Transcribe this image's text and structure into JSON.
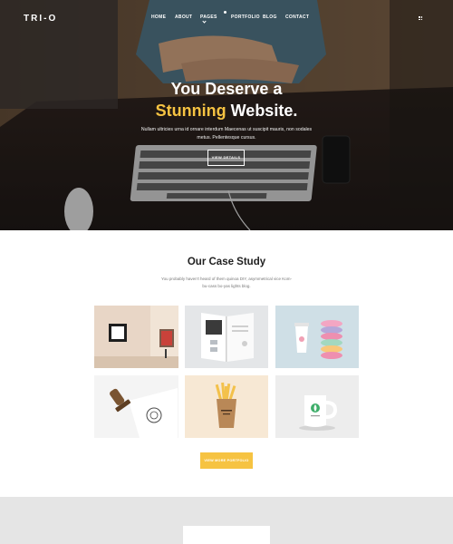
{
  "brand": {
    "logo_text": "TRI-O",
    "accent_color": "#f6c342"
  },
  "nav": {
    "items": [
      {
        "label": "HOME"
      },
      {
        "label": "ABOUT"
      },
      {
        "label": "PAGES"
      },
      {
        "label": "PORTFOLIO"
      },
      {
        "label": "BLOG"
      },
      {
        "label": "CONTACT"
      }
    ],
    "menu_icon": "grid-menu-icon"
  },
  "hero": {
    "title_line1": "You Deserve a",
    "title_accent": "Stunning",
    "title_rest": " Website.",
    "subtitle": "Nullam ultricies urna id ornare interdum Maecenas ut suscipit mauris, non sodales metus. Pellentesque cursus.",
    "button_label": "VIEW DETAILS"
  },
  "case_study": {
    "title": "Our Case Study",
    "subtitle": "You probably haven't heard of them quinoa DIY, asymmetrical vice Kom-bu-cass bo-yas lights blog.",
    "tiles": [
      {
        "name": "gallery-frame"
      },
      {
        "name": "open-book"
      },
      {
        "name": "coffee-cup-macarons"
      },
      {
        "name": "stamp-seal"
      },
      {
        "name": "fries-packaging"
      },
      {
        "name": "mug-mockup"
      }
    ],
    "button_label": "VIEW MORE PORTFOLIO"
  }
}
